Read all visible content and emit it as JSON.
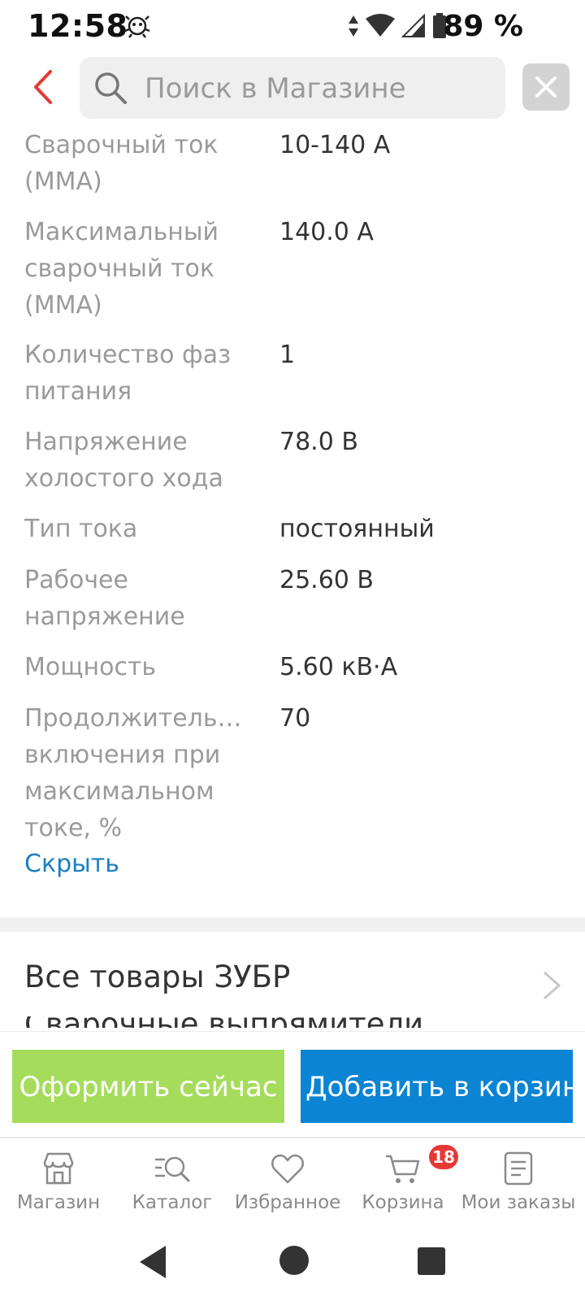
{
  "status_bar": {
    "time": "12:58",
    "battery": "89 %"
  },
  "search": {
    "placeholder": "Поиск в Магазине"
  },
  "specs": [
    {
      "label": "Сварочный ток (ММА)",
      "value": "10-140 А"
    },
    {
      "label": "Максимальный сварочный ток (ММА)",
      "value": "140.0 А"
    },
    {
      "label": "Количество фаз питания",
      "value": "1"
    },
    {
      "label": "Напряжение холостого хода",
      "value": "78.0 В"
    },
    {
      "label": "Тип тока",
      "value": "постоянный"
    },
    {
      "label": "Рабочее напряжение",
      "value": "25.60 В"
    },
    {
      "label": "Мощность",
      "value": "5.60 кВ·А"
    },
    {
      "label": "Продолжитель… включения при максимальном токе, %",
      "value": "70"
    }
  ],
  "hide_link": "Скрыть",
  "store_link": "Все товары ЗУБР",
  "cut_line": "Сварочные выпрямители",
  "actions": {
    "buy_now": "Оформить сейчас",
    "add_to_cart": "Добавить в корзину"
  },
  "nav": [
    {
      "label": "Магазин",
      "icon": "store-icon"
    },
    {
      "label": "Каталог",
      "icon": "catalog-search-icon"
    },
    {
      "label": "Избранное",
      "icon": "heart-icon"
    },
    {
      "label": "Корзина",
      "icon": "cart-icon"
    },
    {
      "label": "Мои заказы",
      "icon": "orders-list-icon"
    }
  ],
  "cart_badge": "18",
  "colors": {
    "accent_blue": "#0c84d4",
    "accent_green": "#a6dc5b",
    "back_red": "#e53935"
  }
}
